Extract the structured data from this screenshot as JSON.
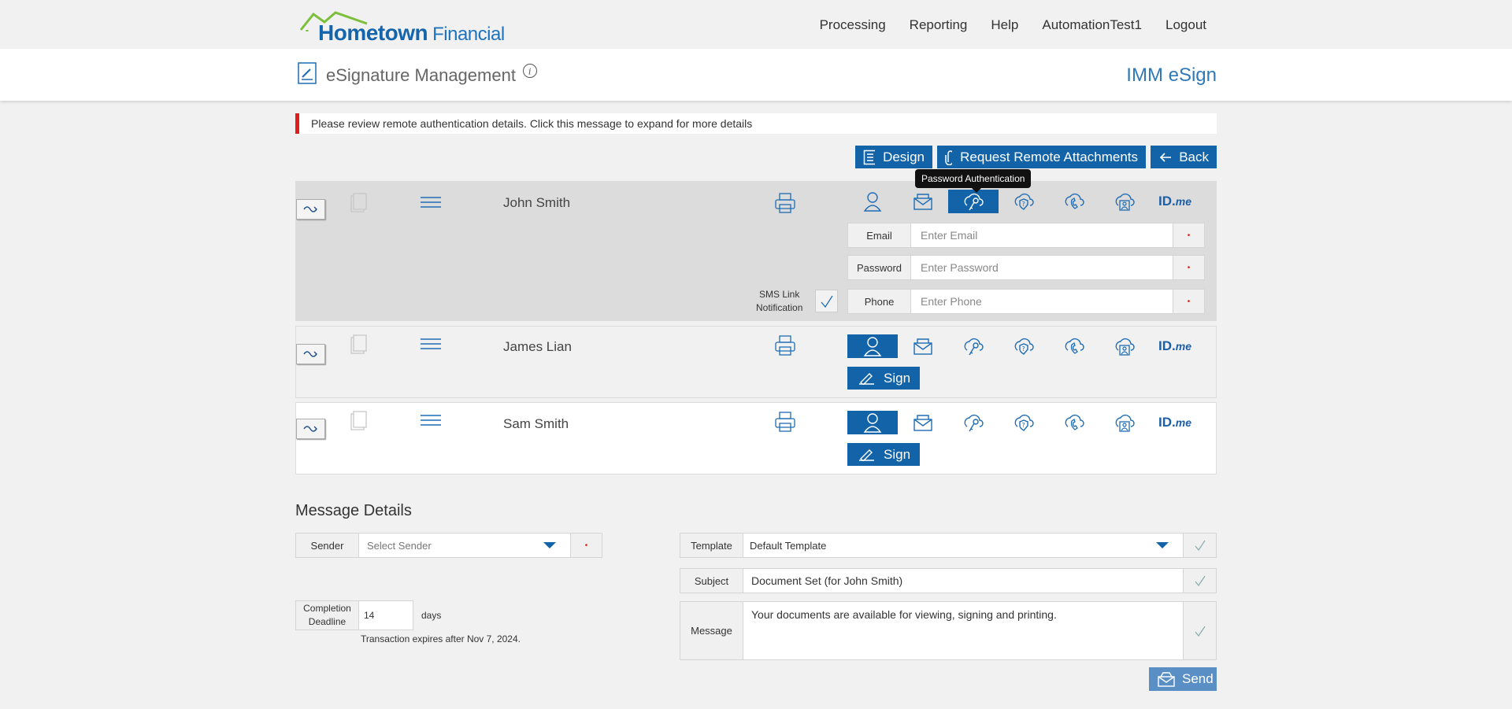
{
  "header": {
    "brand_name": "Hometown",
    "brand_sub": "Financial",
    "nav": [
      "Processing",
      "Reporting",
      "Help",
      "AutomationTest1",
      "Logout"
    ]
  },
  "titlebar": {
    "title": "eSignature Management",
    "app_name": "IMM eSign"
  },
  "alert": {
    "text": "Please review remote authentication details. Click this message to expand for more details"
  },
  "actions": {
    "design": "Design",
    "request_attachments": "Request Remote Attachments",
    "back": "Back"
  },
  "tooltip": "Password Authentication",
  "signers": [
    {
      "name": "John Smith",
      "active_auth": "password"
    },
    {
      "name": "James Lian",
      "active_auth": "user",
      "sign_label": "Sign"
    },
    {
      "name": "Sam Smith",
      "active_auth": "user",
      "sign_label": "Sign"
    }
  ],
  "auth_fields": {
    "email_label": "Email",
    "email_placeholder": "Enter Email",
    "password_label": "Password",
    "password_placeholder": "Enter Password",
    "phone_label": "Phone",
    "phone_placeholder": "Enter Phone",
    "sms_label_1": "SMS Link",
    "sms_label_2": "Notification",
    "required_mark": "•"
  },
  "idme": {
    "id": "ID.",
    "me": "me"
  },
  "message_details": {
    "heading": "Message Details",
    "sender_label": "Sender",
    "sender_value": "Select Sender",
    "deadline_label_1": "Completion",
    "deadline_label_2": "Deadline",
    "deadline_value": "14",
    "deadline_unit": "days",
    "expires_text": "Transaction expires after Nov 7, 2024.",
    "template_label": "Template",
    "template_value": "Default Template",
    "subject_label": "Subject",
    "subject_value": "Document Set (for John Smith)",
    "message_label": "Message",
    "message_value": "Your documents are available for viewing, signing and printing.",
    "send_label": "Send"
  },
  "colors": {
    "primary": "#1263a8",
    "alert": "#e21b1b",
    "send": "#5a8fc5"
  }
}
